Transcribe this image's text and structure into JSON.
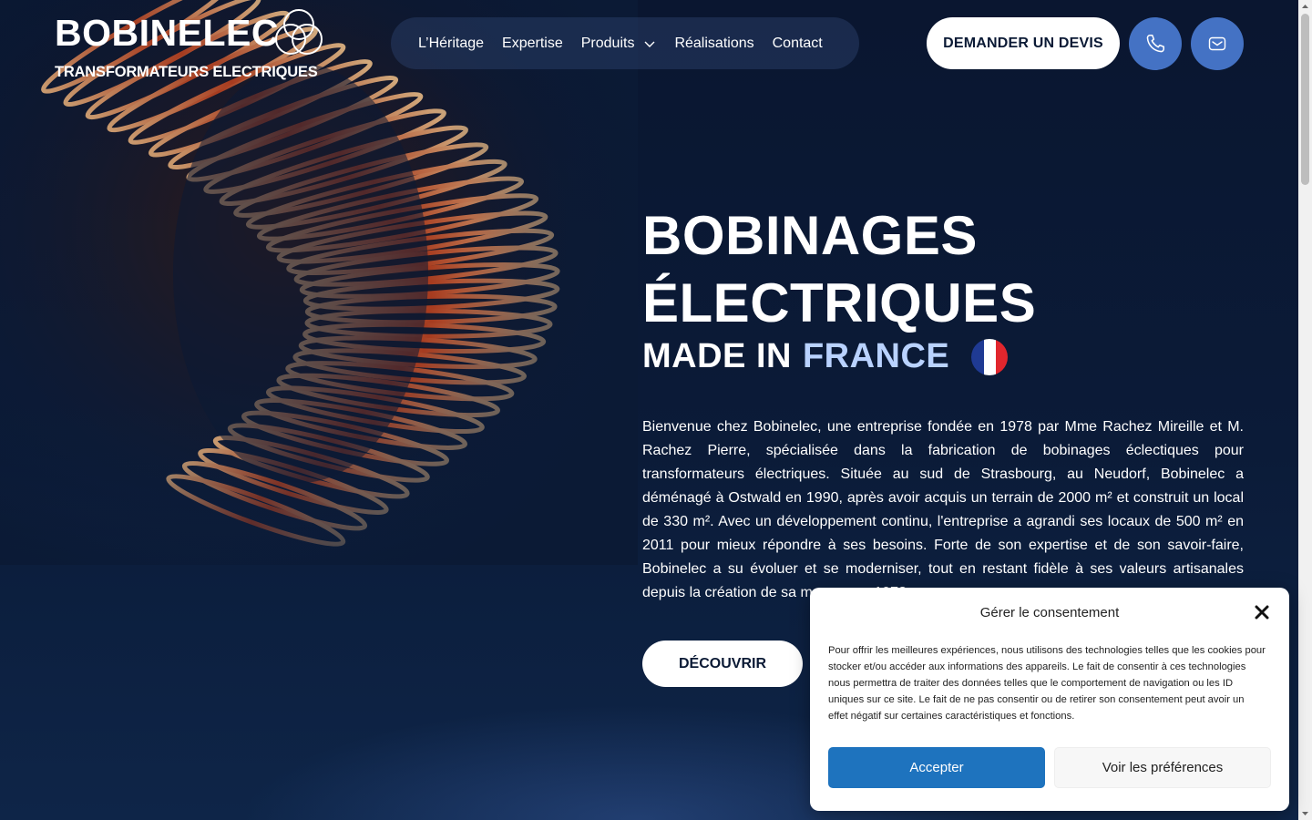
{
  "brand": {
    "name": "BOBINELEC",
    "tagline": "TRANSFORMATEURS ELECTRIQUES"
  },
  "nav": {
    "items": [
      {
        "label": "L’Héritage"
      },
      {
        "label": "Expertise"
      },
      {
        "label": "Produits",
        "has_dropdown": true
      },
      {
        "label": "Réalisations"
      },
      {
        "label": "Contact"
      }
    ]
  },
  "header": {
    "quote_label": "DEMANDER UN DEVIS",
    "phone_icon": "phone-icon",
    "mail_icon": "mail-icon"
  },
  "hero": {
    "title_line1": "BOBINAGES",
    "title_line2": "ÉLECTRIQUES",
    "made_in": "MADE IN",
    "made_in_accent": "FRANCE",
    "flag_colors": [
      "#1f3a93",
      "#ffffff",
      "#e1262d"
    ],
    "intro": "Bienvenue chez Bobinelec, une entreprise fondée en 1978 par Mme Rachez Mireille et M. Rachez Pierre, spécialisée dans la fabrication de bobinages éclectiques pour transformateurs électriques. Située au sud de Strasbourg, au Neudorf, Bobinelec a déménagé à Ostwald en 1990, après avoir acquis un terrain de 2000 m² et construit un local de 330 m². Avec un développement continu, l'entreprise a agrandi ses locaux de 500 m² en 2011 pour mieux répondre à ses besoins. Forte de son expertise et de son savoir-faire, Bobinelec a su évoluer et se moderniser, tout en restant fidèle à ses valeurs artisanales depuis la création de sa marque en 1978.",
    "cta_label": "DÉCOUVRIR"
  },
  "consent": {
    "title": "Gérer le consentement",
    "body": "Pour offrir les meilleures expériences, nous utilisons des technologies telles que les cookies pour stocker et/ou accéder aux informations des appareils. Le fait de consentir à ces technologies nous permettra de traiter des données telles que le comportement de navigation ou les ID uniques sur ce site. Le fait de ne pas consentir ou de retirer son consentement peut avoir un effet négatif sur certaines caractéristiques et fonctions.",
    "accept_label": "Accepter",
    "prefs_label": "Voir les préférences"
  },
  "colors": {
    "background": "#0b1a35",
    "accent_blue": "#4472c4",
    "france_accent": "#b9d2ff",
    "accept_blue": "#1e73be"
  }
}
